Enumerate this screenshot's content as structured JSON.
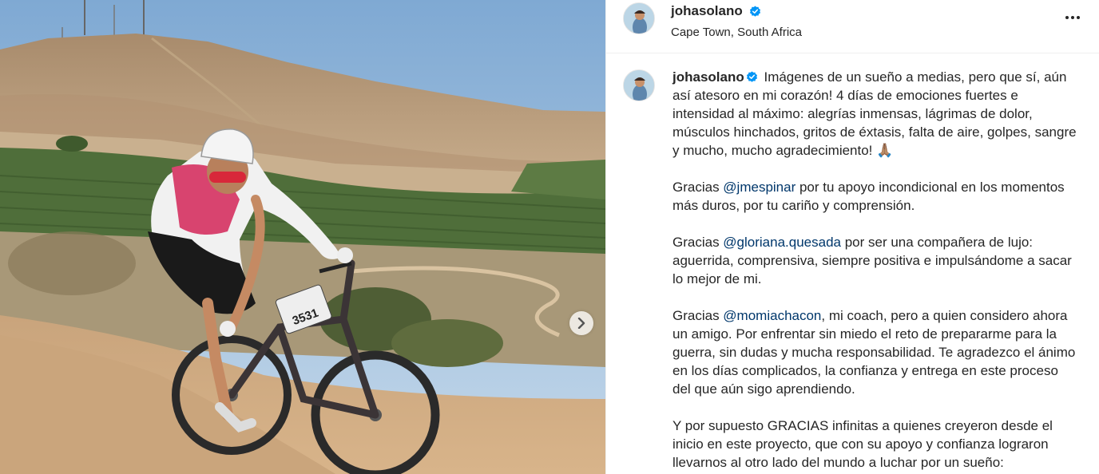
{
  "post": {
    "username": "johasolano",
    "location": "Cape Town, South Africa",
    "bib_number": "3531"
  },
  "icons": {
    "verified": "verified-badge-icon",
    "more": "more-options-icon",
    "next": "chevron-right-icon"
  },
  "colors": {
    "verified": "#0095f6",
    "mention": "#00376b",
    "text": "#262626"
  },
  "caption": {
    "username": "johasolano",
    "p1": "Imágenes de un sueño a medias, pero que sí, aún así atesoro en mi corazón! 4 días de emociones fuertes e intensidad al máximo: alegrías inmensas, lágrimas de dolor, músculos hinchados, gritos de éxtasis, falta de aire, golpes, sangre y mucho, mucho agradecimiento! 🙏🏽",
    "p2_pre": "Gracias ",
    "p2_mention": "@jmespinar",
    "p2_post": " por tu apoyo incondicional en los momentos más duros, por tu cariño y comprensión.",
    "p3_pre": "Gracias ",
    "p3_mention": "@gloriana.quesada",
    "p3_post": " por ser una compañera de lujo: aguerrida, comprensiva, siempre positiva e impulsándome a sacar lo mejor de mi.",
    "p4_pre": "Gracias ",
    "p4_mention": "@momiachacon",
    "p4_post": ", mi coach, pero a quien considero ahora un amigo. Por enfrentar sin miedo el reto de prepararme para la guerra, sin dudas y mucha responsabilidad. Te agradezco el ánimo en los días complicados, la confianza y entrega en este proceso del que aún sigo aprendiendo.",
    "p5": "Y por supuesto GRACIAS infinitas a quienes creyeron desde el inicio en este proyecto, que con su apoyo y confianza lograron llevarnos al otro lado del mundo a luchar por un sueño:"
  }
}
